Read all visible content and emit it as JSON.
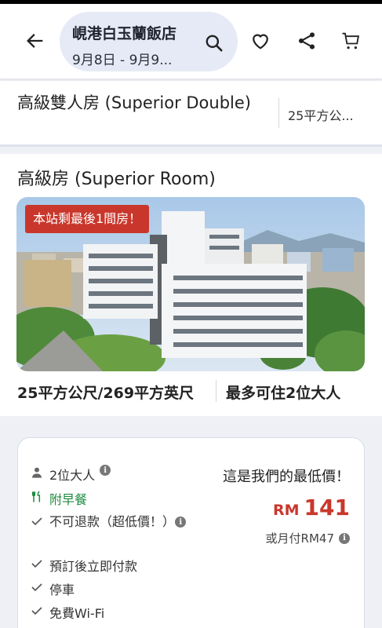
{
  "header": {
    "hotel_name": "峴港白玉蘭飯店",
    "dates": "9月8日 - 9月9..."
  },
  "room_type": {
    "name": "高級雙人房 (Superior Double)",
    "size": "25平方公..."
  },
  "room": {
    "title": "高級房 (Superior Room)",
    "badge": "本站剩最後1間房！",
    "size": "25平方公尺/269平方英尺",
    "occupancy": "最多可住2位大人"
  },
  "offer": {
    "guests": "2位大人",
    "breakfast": "附早餐",
    "refund": "不可退款（超低價！）",
    "pay_now": "預訂後立即付款",
    "parking": "停車",
    "wifi": "免費Wi-Fi",
    "lowest_price_note": "這是我們的最低價！",
    "currency": "RM",
    "price": "141",
    "monthly": "或月付RM47"
  },
  "colors": {
    "accent_red": "#c9372c",
    "pill_bg": "#e6eaf6",
    "green": "#1c8a3e"
  }
}
